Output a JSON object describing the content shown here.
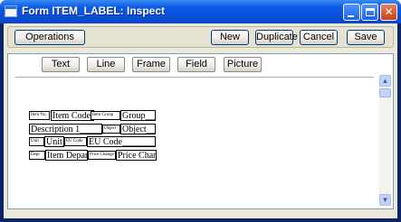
{
  "window": {
    "title": "Form ITEM_LABEL: Inspect"
  },
  "toolbar": {
    "operations": "Operations",
    "new": "New",
    "duplicate": "Duplicate",
    "cancel": "Cancel",
    "save": "Save"
  },
  "tools": {
    "text": "Text",
    "line": "Line",
    "frame": "Frame",
    "field": "Field",
    "picture": "Picture"
  },
  "form": {
    "row1": {
      "lbl1": "Item No.",
      "fld1": "Item Code__",
      "lbl2": "Item Group",
      "fld2": "Group____"
    },
    "row2": {
      "fld1": "Description 1________",
      "lbl1": "Object",
      "fld2": "Object___"
    },
    "row3": {
      "lbl1": "Unit",
      "fld1": "Unit_",
      "lbl2": "EU Code",
      "fld2": "EU Code________"
    },
    "row4": {
      "lbl1": "Dept",
      "fld1": "Item Departm",
      "lbl2": "Price Change",
      "fld2": "Price Change"
    }
  }
}
